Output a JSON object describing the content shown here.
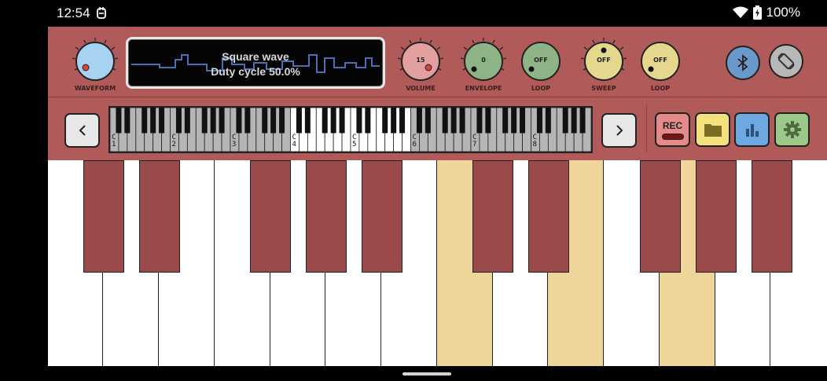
{
  "status": {
    "time": "12:54",
    "battery": "100%"
  },
  "display": {
    "line1": "Square wave",
    "line2": "Duty cycle 50.0%"
  },
  "knobs": [
    {
      "id": "waveform",
      "label": "WAVEFORM",
      "value": "",
      "color": "#a7d2f2"
    },
    {
      "id": "volume",
      "label": "VOLUME",
      "value": "15",
      "color": "#e3a0a0"
    },
    {
      "id": "envelope",
      "label": "ENVELOPE",
      "value": "0",
      "color": "#8eb386"
    },
    {
      "id": "loop1",
      "label": "LOOP",
      "value": "OFF",
      "color": "#8eb386"
    },
    {
      "id": "sweep",
      "label": "SWEEP",
      "value": "OFF",
      "color": "#e5d78d"
    },
    {
      "id": "loop2",
      "label": "LOOP",
      "value": "OFF",
      "color": "#e5d78d"
    }
  ],
  "buttons": {
    "rec_label": "REC"
  },
  "mini_keyboard": {
    "octave_labels": [
      "C1",
      "C2",
      "C3",
      "C4",
      "C5",
      "C6",
      "C7",
      "C8"
    ]
  },
  "colors": {
    "panel": "#b05a5a",
    "black_key": "#9a4a4a",
    "pressed_key": "#f0d59a",
    "bluetooth": "#6a98c8",
    "rotate": "#b8b8b8",
    "folder": "#f3e27e",
    "chart": "#6ea8e0",
    "settings": "#9cc88a",
    "rec": "#e58a8a"
  }
}
